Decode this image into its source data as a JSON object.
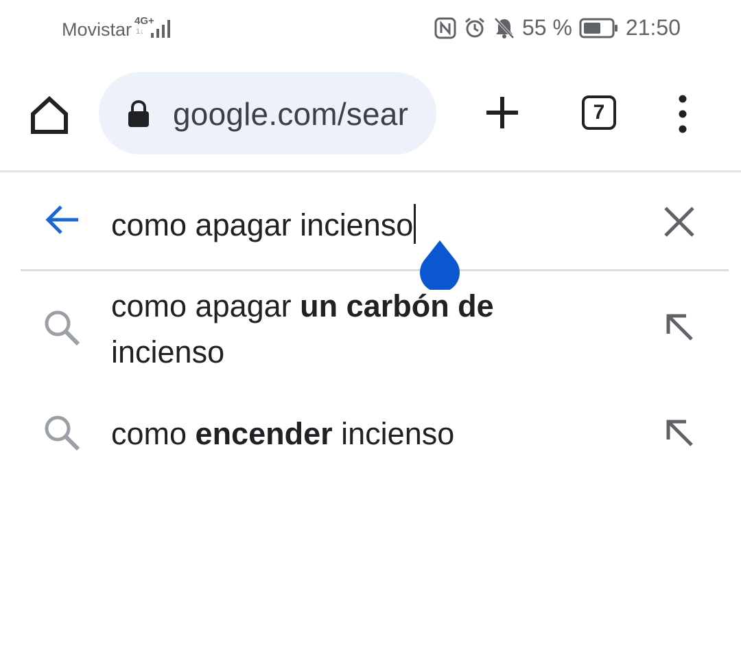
{
  "status_bar": {
    "carrier": "Movistar",
    "network_type": "4G+",
    "network_sub": "1↓",
    "battery_percent": "55 %",
    "time": "21:50",
    "icons": [
      "nfc-icon",
      "alarm-icon",
      "notifications-off-icon",
      "battery-icon",
      "signal-icon"
    ]
  },
  "toolbar": {
    "url": "google.com/sear",
    "tab_count": "7",
    "icons": [
      "home-icon",
      "lock-icon",
      "plus-icon",
      "more-vert-icon"
    ]
  },
  "search": {
    "query": "como apagar incienso",
    "accent_color": "#1967d2",
    "handle_color": "#0b57d0"
  },
  "suggestions": [
    {
      "prefix": "como apagar ",
      "bold": "un carbón de",
      "suffix": "incienso"
    },
    {
      "prefix": "como ",
      "bold": "encender",
      "suffix": " incienso"
    }
  ]
}
